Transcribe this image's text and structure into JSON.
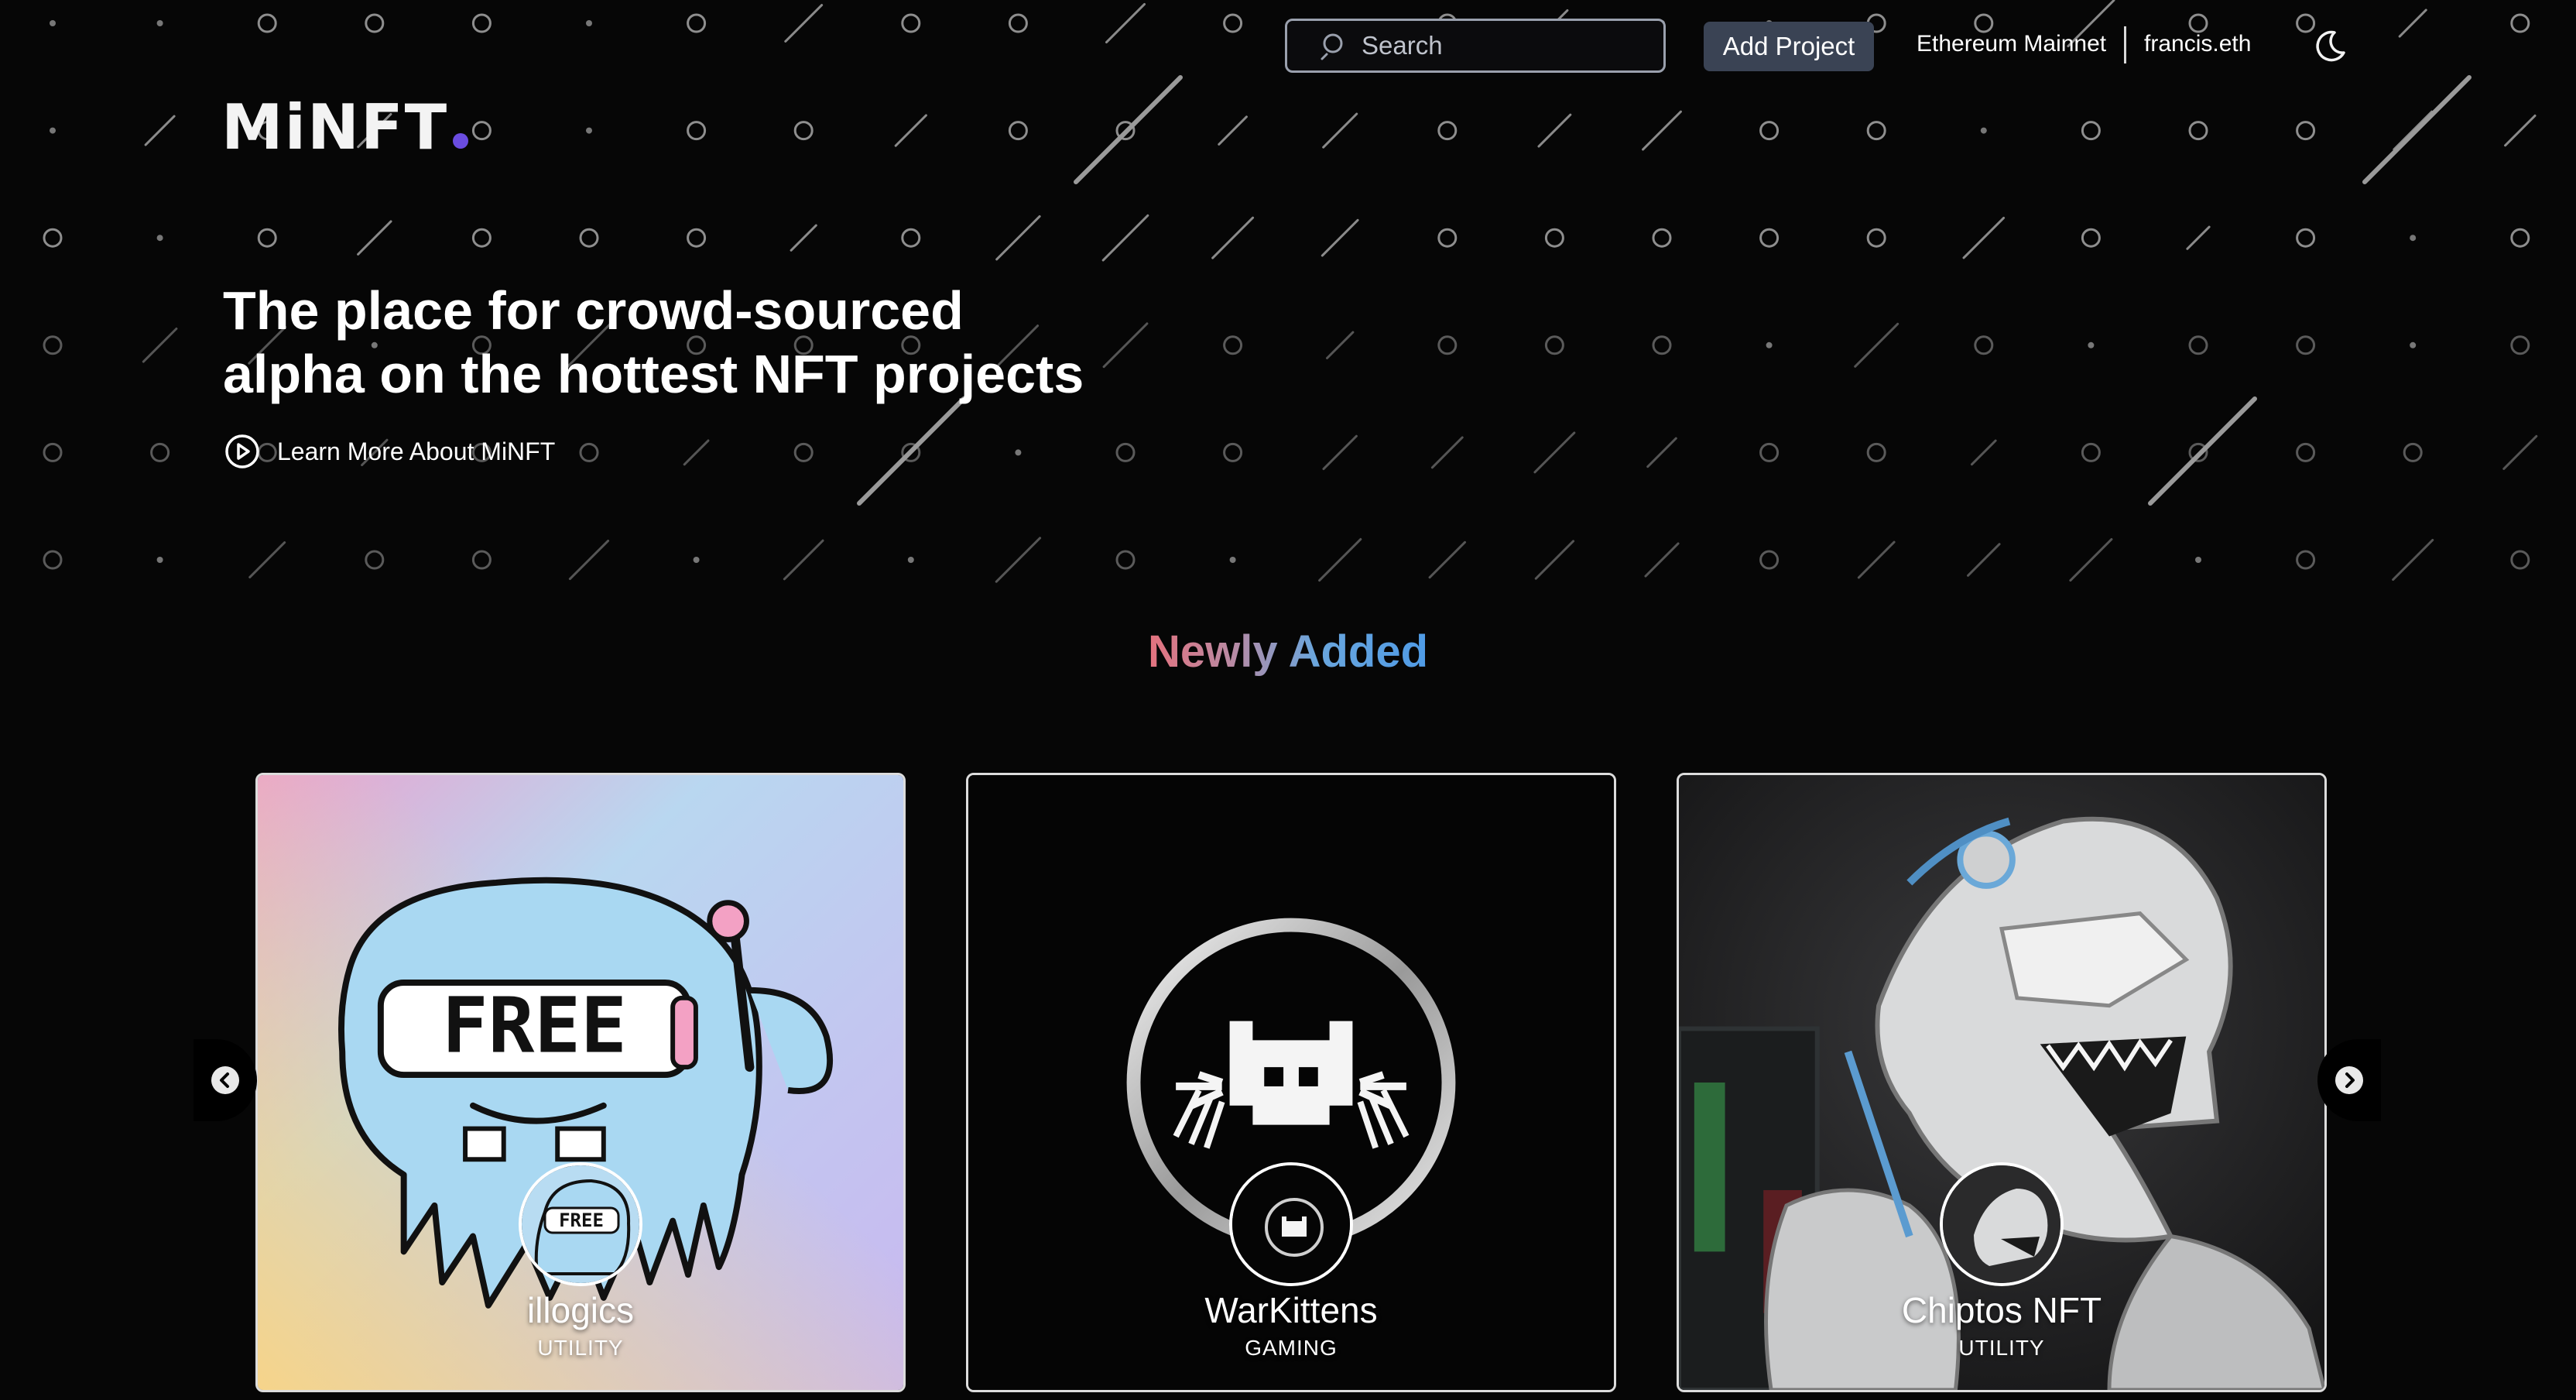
{
  "brand": {
    "logo_text": "MiNFT",
    "accent_color": "#6a4ce0"
  },
  "header": {
    "search_placeholder": "Search",
    "add_project_label": "Add Project",
    "network_label": "Ethereum Mainnet",
    "account_label": "francis.eth",
    "theme_icon": "moon-icon"
  },
  "hero": {
    "title": "The place for crowd-sourced alpha on the hottest NFT projects",
    "learn_more_label": "Learn More About MiNFT",
    "learn_more_icon": "play-circle-icon"
  },
  "section": {
    "title": "Newly Added",
    "gradient_colors": [
      "#e4727e",
      "#4f9be6"
    ]
  },
  "carousel": {
    "prev_icon": "chevron-left-icon",
    "next_icon": "chevron-right-icon",
    "cards": [
      {
        "name": "illogics",
        "category": "UTILITY"
      },
      {
        "name": "WarKittens",
        "category": "GAMING"
      },
      {
        "name": "Chiptos NFT",
        "category": "UTILITY"
      }
    ]
  }
}
